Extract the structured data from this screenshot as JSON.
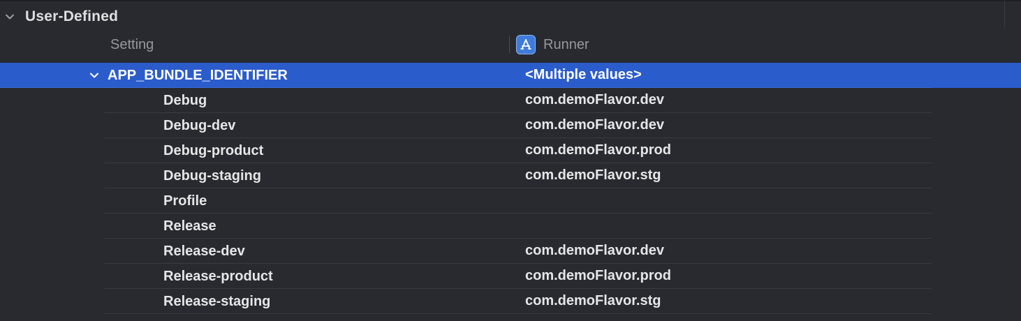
{
  "section": {
    "title": "User-Defined",
    "chevron_icon": "chevron-down-icon"
  },
  "columns": {
    "setting": "Setting",
    "target": "Runner",
    "target_icon": "app-store-icon"
  },
  "setting": {
    "name": "APP_BUNDLE_IDENTIFIER",
    "value": "<Multiple values>",
    "expanded_icon": "chevron-down-icon",
    "configurations": [
      {
        "name": "Debug",
        "value": "com.demoFlavor.dev"
      },
      {
        "name": "Debug-dev",
        "value": "com.demoFlavor.dev"
      },
      {
        "name": "Debug-product",
        "value": "com.demoFlavor.prod"
      },
      {
        "name": "Debug-staging",
        "value": "com.demoFlavor.stg"
      },
      {
        "name": "Profile",
        "value": ""
      },
      {
        "name": "Release",
        "value": ""
      },
      {
        "name": "Release-dev",
        "value": "com.demoFlavor.dev"
      },
      {
        "name": "Release-product",
        "value": "com.demoFlavor.prod"
      },
      {
        "name": "Release-staging",
        "value": "com.demoFlavor.stg"
      }
    ]
  },
  "colors": {
    "background": "#292a30",
    "selection": "#2b5ccc",
    "separator": "#3a3b41",
    "header_text": "#97979d",
    "row_text": "#e6e6e8",
    "app_icon": "#3f7bd9"
  }
}
